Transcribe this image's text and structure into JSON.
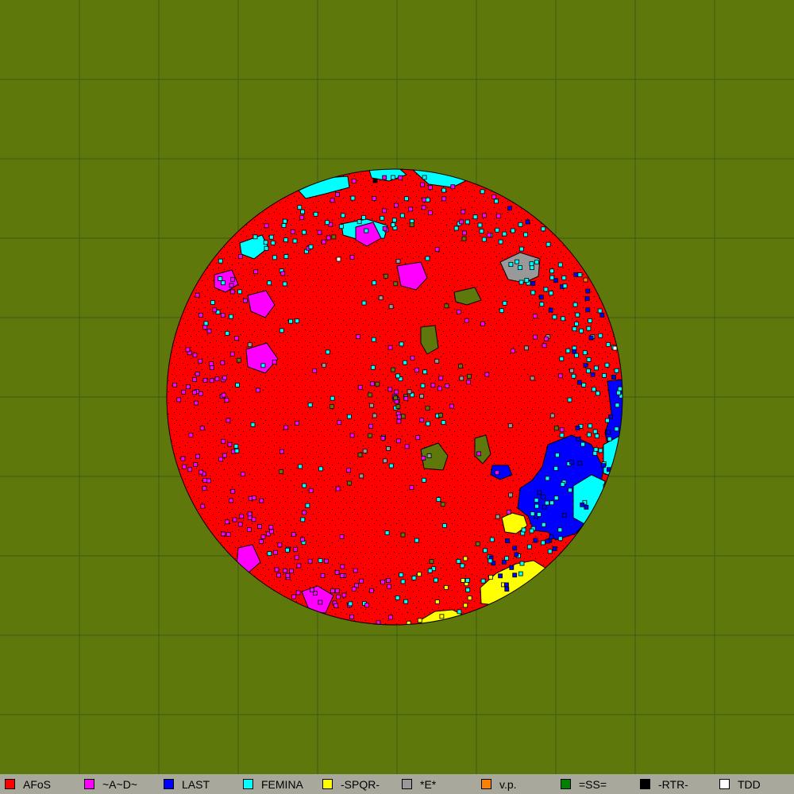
{
  "map": {
    "background_color": "#5e780b",
    "grid_color": "#3c5a1a",
    "grid_spacing_cells": 100,
    "outline_color": "#000000"
  },
  "alliances": [
    {
      "name": "AFoS",
      "color": "#ff0000",
      "icon": "red-square"
    },
    {
      "name": "~A~D~",
      "color": "#ff00ff",
      "icon": "magenta-square"
    },
    {
      "name": "LAST",
      "color": "#0000ff",
      "icon": "blue-square"
    },
    {
      "name": "FEMINA",
      "color": "#00ffff",
      "icon": "cyan-square"
    },
    {
      "name": "-SPQR-",
      "color": "#ffff00",
      "icon": "yellow-square"
    },
    {
      "name": "*E*",
      "color": "#999999",
      "icon": "gray-square"
    },
    {
      "name": "v.p.",
      "color": "#ff8000",
      "icon": "orange-square"
    },
    {
      "name": "=SS=",
      "color": "#008000",
      "icon": "green-square"
    },
    {
      "name": "-RTR-",
      "color": "#000000",
      "icon": "black-square"
    },
    {
      "name": "TDD",
      "color": "#ffffff",
      "icon": "white-square"
    }
  ]
}
